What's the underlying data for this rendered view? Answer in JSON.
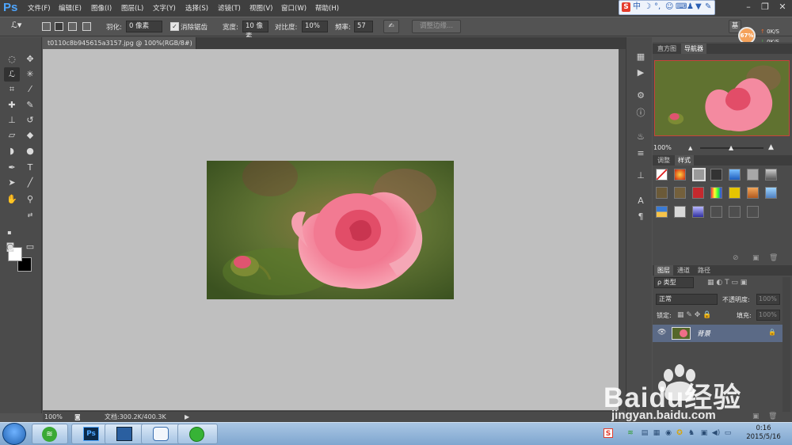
{
  "app": {
    "logo": "Ps"
  },
  "menus": [
    "文件(F)",
    "编辑(E)",
    "图像(I)",
    "图层(L)",
    "文字(Y)",
    "选择(S)",
    "滤镜(T)",
    "视图(V)",
    "窗口(W)",
    "帮助(H)"
  ],
  "ime": {
    "logo": "S",
    "lang": "中"
  },
  "options": {
    "feather_label": "羽化:",
    "feather_value": "0 像素",
    "antialias_label": "消除锯齿",
    "width_label": "宽度:",
    "width_value": "10 像素",
    "contrast_label": "对比度:",
    "contrast_value": "10%",
    "frequency_label": "频率:",
    "frequency_value": "57",
    "refine_button": "调整边缘..."
  },
  "network": {
    "percent": "67%",
    "up": "0K/S",
    "down": "0K/S"
  },
  "document": {
    "tab_title": "t0110c8b945615a3157.jpg @ 100%(RGB/8#) *"
  },
  "status": {
    "zoom": "100%",
    "doc_info": "文档:300.2K/400.3K"
  },
  "panels": {
    "histogram_tab": "直方图",
    "navigator_tab": "导航器",
    "nav_zoom": "100%",
    "adjust_tab": "调整",
    "styles_tab": "样式",
    "layers_tab": "图层",
    "channels_tab": "通道",
    "paths_tab": "路径",
    "filter_type": "ρ 类型",
    "blend_mode": "正常",
    "opacity_label": "不透明度:",
    "opacity_value": "100%",
    "lock_label": "锁定:",
    "fill_label": "填充:",
    "fill_value": "100%",
    "layer_name": "背景"
  },
  "taskbar": {
    "ps_label": "Ps",
    "ime_tray": "S",
    "time": "0:16",
    "date": "2015/5/16"
  },
  "watermark": {
    "brand": "Baidu经验",
    "url": "jingyan.baidu.com"
  },
  "colors": {
    "accent": "#4ea6ff",
    "selection_border": "#c8443a",
    "layer_highlight": "#5b6a86"
  }
}
